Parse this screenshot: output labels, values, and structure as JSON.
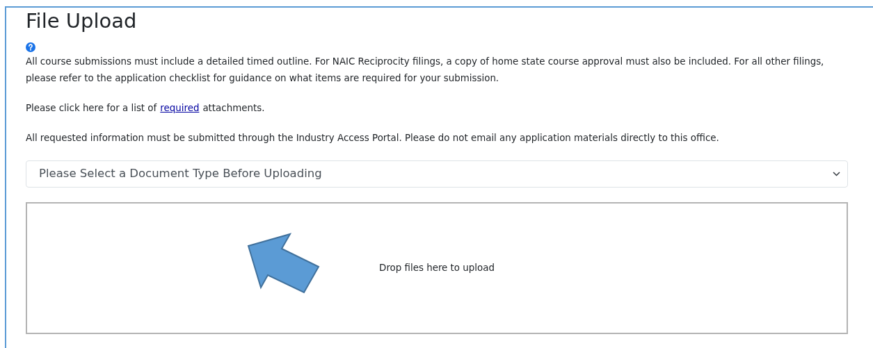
{
  "title": "File Upload",
  "intro": "All course submissions must include a detailed timed outline. For NAIC Reciprocity filings, a copy of home state course approval must also be included. For all other filings, please refer to the application checklist for guidance on what items are required for your submission.",
  "required_line": {
    "before": "Please click here for a list of",
    "link": "required",
    "after": "attachments."
  },
  "notice": "All requested information must be submitted through the Industry Access Portal. Please do not email any application materials directly to this office.",
  "document_type": {
    "value": "Please Select a Document Type Before Uploading"
  },
  "dropzone": {
    "message": "Drop files here to upload"
  }
}
